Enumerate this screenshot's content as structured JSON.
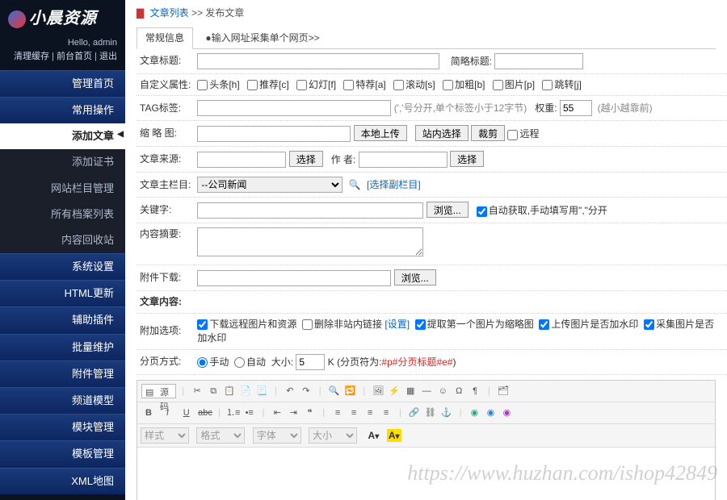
{
  "logo": "小晨资源",
  "greet_prefix": "Hello, ",
  "greet_user": "admin",
  "sublinks": {
    "a": "清理缓存",
    "b": "前台首页",
    "c": "退出"
  },
  "nav": {
    "home": "管理首页",
    "common": "常用操作",
    "items": [
      "添加文章",
      "添加证书",
      "网站栏目管理",
      "所有档案列表",
      "内容回收站"
    ],
    "sys": "系统设置",
    "html": "HTML更新",
    "plugin": "辅助插件",
    "batch": "批量维护",
    "attach": "附件管理",
    "channel": "频道模型",
    "module": "模块管理",
    "tpl": "模板管理",
    "xml": "XML地图"
  },
  "crumb": {
    "a": "文章列表",
    "sep": ">>",
    "b": "发布文章"
  },
  "tabs": {
    "t1": "常规信息",
    "t2": "●输入网址采集单个网页>>"
  },
  "row_title": {
    "lbl": "文章标题:",
    "lbl2": "简略标题:"
  },
  "row_attr": {
    "lbl": "自定义属性:",
    "opts": [
      "头条[h]",
      "推荐[c]",
      "幻灯[f]",
      "特荐[a]",
      "滚动[s]",
      "加粗[b]",
      "图片[p]",
      "跳转[j]"
    ]
  },
  "row_tag": {
    "lbl": "TAG标签:",
    "hint": "(','号分开,单个标签小于12字节)",
    "wlbl": "权重:",
    "wval": "55",
    "whint": "(越小越靠前)"
  },
  "row_thumb": {
    "lbl": "缩 略 图:",
    "b1": "本地上传",
    "b2": "站内选择",
    "b3": "裁剪",
    "cb": "远程"
  },
  "row_src": {
    "lbl": "文章来源:",
    "btn": "选择",
    "lbl2": "作 者:",
    "btn2": "选择"
  },
  "row_col": {
    "lbl": "文章主栏目:",
    "sel": "--公司新闻",
    "link": "[选择副栏目]"
  },
  "row_kw": {
    "lbl": "关键字:",
    "btn": "浏览...",
    "cb": "自动获取,手动填写用\",\"分开"
  },
  "row_sum": {
    "lbl": "内容摘要:"
  },
  "row_dl": {
    "lbl": "附件下载:",
    "btn": "浏览..."
  },
  "row_body": {
    "lbl": "文章内容:"
  },
  "row_opt": {
    "lbl": "附加选项:",
    "o1": "下载远程图片和资源",
    "o1s": "删除非站内链接",
    "o1set": "[设置]",
    "o2": "提取第一个图片为缩略图",
    "o3": "上传图片是否加水印",
    "o4": "采集图片是否加水印"
  },
  "row_pg": {
    "lbl": "分页方式:",
    "r1": "手动",
    "r2": "自动",
    "sz": "大小:",
    "szv": "5",
    "k": "K (分页符为:",
    "mark": "#p#分页标题#e#",
    "end": ")"
  },
  "ed": {
    "src": "源码",
    "fmt": [
      "样式",
      "格式",
      "字体",
      "大小"
    ]
  },
  "watermark": "https://www.huzhan.com/ishop42849"
}
